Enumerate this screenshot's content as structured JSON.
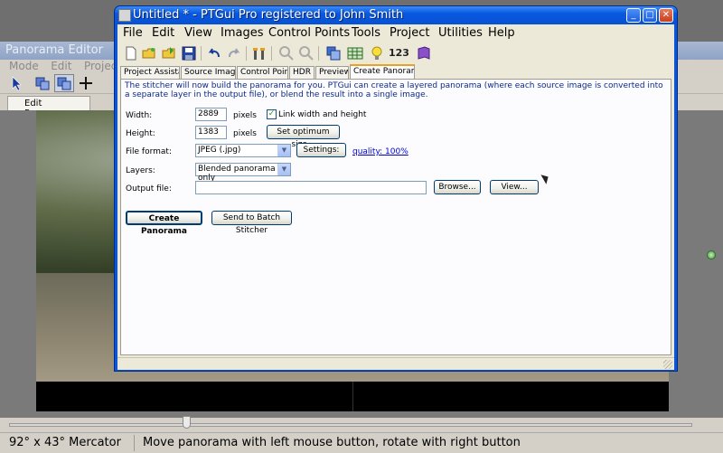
{
  "pano_editor": {
    "title": "Panorama Editor",
    "menu": [
      "Mode",
      "Edit",
      "Project"
    ],
    "tab_label": "Edit Panorama",
    "projection": "92° x 43° Mercator",
    "hint": "Move panorama with left mouse button, rotate with right button"
  },
  "ptgui": {
    "title": "Untitled * - PTGui Pro registered to John Smith",
    "menu": [
      "File",
      "Edit",
      "View",
      "Images",
      "Control Points",
      "Tools",
      "Project",
      "Utilities",
      "Help"
    ],
    "toolbar_counter": "123",
    "tabs": [
      "Project Assistant",
      "Source Images",
      "Control Points",
      "HDR",
      "Preview",
      "Create Panorama"
    ],
    "description": "The stitcher will now build the panorama for you. PTGui can create a layered panorama (where each source image is converted into a separate layer in the output file), or blend the result into a single image.",
    "form": {
      "width_label": "Width:",
      "width_value": "2889",
      "width_unit": "pixels",
      "link_label": "Link width and height",
      "link_checked": true,
      "height_label": "Height:",
      "height_value": "1383",
      "height_unit": "pixels",
      "optimum_label": "Set optimum size...",
      "format_label": "File format:",
      "format_value": "JPEG (.jpg)",
      "settings_label": "Settings:",
      "quality_label": "quality: 100%",
      "layers_label": "Layers:",
      "layers_value": "Blended panorama only",
      "output_label": "Output file:",
      "output_value": "",
      "browse_label": "Browse...",
      "view_label": "View...",
      "create_label": "Create Panorama",
      "batch_label": "Send to Batch Stitcher"
    }
  },
  "colors": {
    "xp_title_blue": "#0858e0",
    "panel_bg": "#ece9d8",
    "link_blue": "#0000cc",
    "active_tab_accent": "#e9a320"
  },
  "icons": [
    "new-icon",
    "open-icon",
    "open-recent-icon",
    "save-icon",
    "undo-icon",
    "redo-icon",
    "control-points-tool-icon",
    "zoom-in-icon",
    "zoom-out-icon",
    "panorama-editor-icon",
    "table-icon",
    "lightbulb-icon",
    "numbering-icon",
    "help-book-icon"
  ]
}
